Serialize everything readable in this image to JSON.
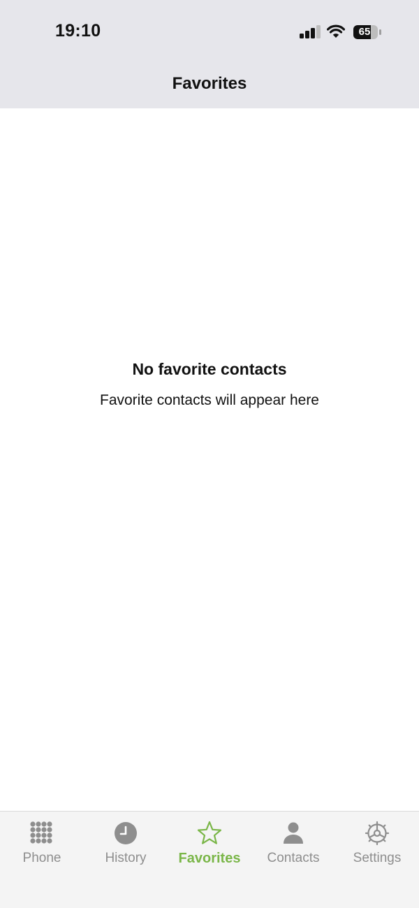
{
  "status_bar": {
    "time": "19:10",
    "battery_level": "65",
    "icons": [
      "signal-icon",
      "wifi-icon",
      "battery-icon"
    ]
  },
  "header": {
    "title": "Favorites"
  },
  "empty_state": {
    "title": "No favorite contacts",
    "subtitle": "Favorite contacts will appear here"
  },
  "tab_bar": {
    "active_tab": "Favorites",
    "tabs": [
      {
        "label": "Phone",
        "icon": "keypad-icon"
      },
      {
        "label": "History",
        "icon": "clock-icon"
      },
      {
        "label": "Favorites",
        "icon": "star-icon"
      },
      {
        "label": "Contacts",
        "icon": "person-icon"
      },
      {
        "label": "Settings",
        "icon": "gear-icon"
      }
    ]
  },
  "colors": {
    "header_background": "#e6e6eb",
    "accent": "#7ab648",
    "inactive": "#8e8e8e",
    "tab_bar_background": "#f4f4f4"
  }
}
